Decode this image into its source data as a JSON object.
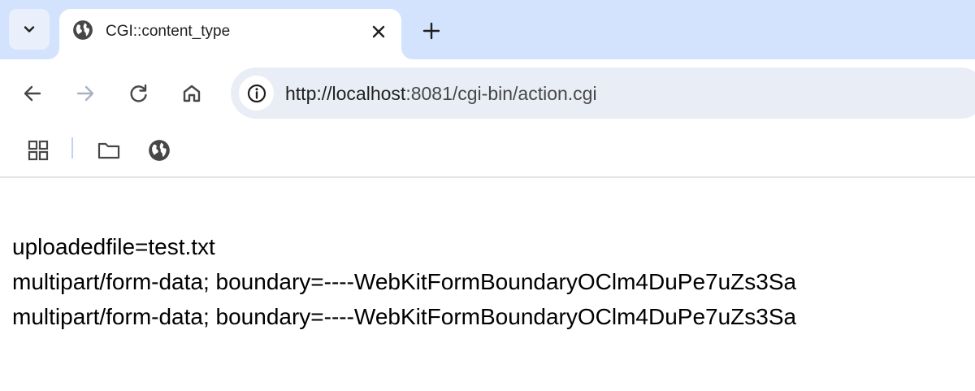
{
  "tab": {
    "title": "CGI::content_type",
    "favicon": "globe-icon",
    "close_icon": "close-icon",
    "search_icon": "chevron-down-icon",
    "new_tab_icon": "plus-icon"
  },
  "toolbar": {
    "back_icon": "arrow-left-icon",
    "forward_icon": "arrow-right-icon",
    "reload_icon": "reload-icon",
    "home_icon": "home-icon",
    "site_info_icon": "info-icon",
    "url_host": "http://localhost",
    "url_rest": ":8081/cgi-bin/action.cgi"
  },
  "bookmarks": {
    "apps_icon": "apps-grid-icon",
    "folder_icon": "folder-icon",
    "globe_icon": "globe-icon"
  },
  "page": {
    "lines": [
      "uploadedfile=test.txt",
      "multipart/form-data; boundary=----WebKitFormBoundaryOClm4DuPe7uZs3Sa",
      "multipart/form-data; boundary=----WebKitFormBoundaryOClm4DuPe7uZs3Sa"
    ]
  },
  "colors": {
    "tabstrip": "#d3e3fd",
    "omnibox": "#e9eef6",
    "icon": "#474747",
    "disabled_icon": "#a8b3c2"
  }
}
